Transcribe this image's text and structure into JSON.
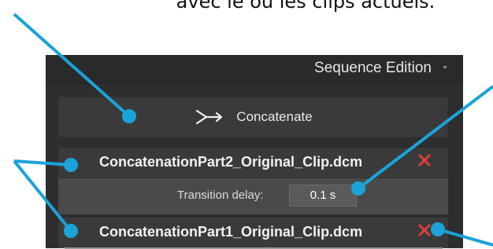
{
  "caption": "avec le ou les clips actuels.",
  "panel": {
    "title": "Sequence Edition",
    "concatenate_label": "Concatenate",
    "clips": [
      {
        "name": "ConcatenationPart2_Original_Clip.dcm"
      },
      {
        "name": "ConcatenationPart1_Original_Clip.dcm"
      }
    ],
    "transition": {
      "label": "Transition delay:",
      "value": "0.1 s"
    }
  },
  "colors": {
    "annotation": "#1aa3d9",
    "remove": "#e0403a",
    "panel_bg": "#2e2e2e"
  }
}
